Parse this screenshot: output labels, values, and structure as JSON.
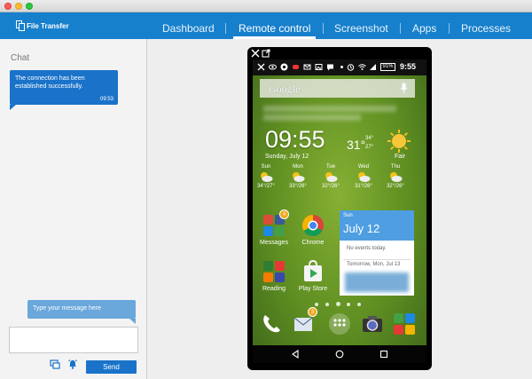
{
  "brand": {
    "name": "File Transfer",
    "icon": "file-copy-icon"
  },
  "nav": {
    "items": [
      {
        "label": "Dashboard",
        "active": false
      },
      {
        "label": "Remote control",
        "active": true
      },
      {
        "label": "Screenshot",
        "active": false
      },
      {
        "label": "Apps",
        "active": false
      },
      {
        "label": "Processes",
        "active": false
      }
    ]
  },
  "chat": {
    "title": "Chat",
    "received": {
      "text": "The connection has been established successfully.",
      "time": "09:53"
    },
    "compose_hint": "Type your message here",
    "input_value": "",
    "send_label": "Send",
    "tool_icons": [
      "screen-share-icon",
      "alarm-icon"
    ]
  },
  "frame": {
    "icons": [
      "close-icon",
      "open-external-icon"
    ]
  },
  "phone": {
    "status": {
      "time": "9:55",
      "battery": "91%"
    },
    "search": {
      "logo": "Google"
    },
    "clock": "09:55",
    "date": "Sunday, July 12",
    "temp": "31°",
    "temp_hi": "34°",
    "temp_lo": "27°",
    "condition": "Fair",
    "forecast": [
      {
        "day": "Sun",
        "temps": "34°/27°"
      },
      {
        "day": "Mon",
        "temps": "33°/26°"
      },
      {
        "day": "Tue",
        "temps": "32°/26°"
      },
      {
        "day": "Wed",
        "temps": "31°/26°"
      },
      {
        "day": "Thu",
        "temps": "32°/26°"
      }
    ],
    "apps": [
      {
        "label": "Messages",
        "icon": "messages-folder-icon",
        "badge": "4"
      },
      {
        "label": "Chrome",
        "icon": "chrome-icon",
        "badge": ""
      },
      {
        "label": "Reading",
        "icon": "reading-folder-icon",
        "badge": ""
      },
      {
        "label": "Play Store",
        "icon": "play-store-icon",
        "badge": ""
      }
    ],
    "calendar": {
      "day": "Sun",
      "date": "July 12",
      "no_events": "No events today.",
      "tomorrow": "Tomorrow, Mon, Jul 13"
    },
    "dock": {
      "mail_badge": "3"
    }
  }
}
